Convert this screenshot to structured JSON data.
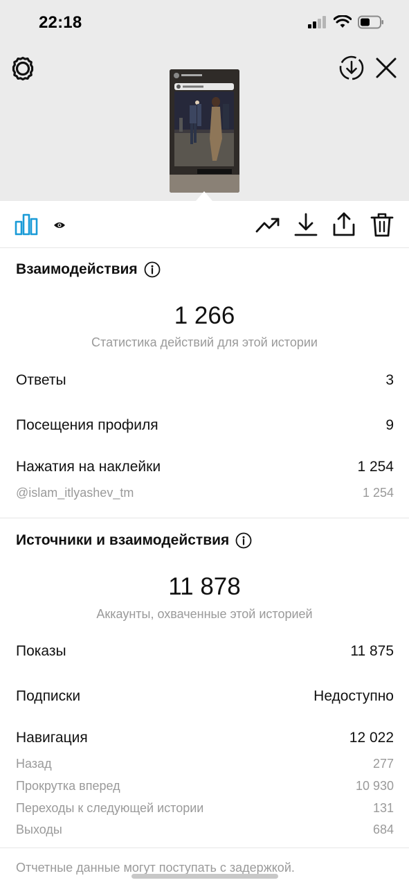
{
  "status_bar": {
    "time": "22:18"
  },
  "story": {
    "username": "islam_itlyashev_tm"
  },
  "interactions": {
    "title": "Взаимодействия",
    "total": "1 266",
    "caption": "Статистика действий для этой истории",
    "rows": [
      {
        "label": "Ответы",
        "value": "3"
      },
      {
        "label": "Посещения профиля",
        "value": "9"
      },
      {
        "label": "Нажатия на наклейки",
        "value": "1 254"
      }
    ],
    "sticker_row": {
      "label": "@islam_itlyashev_tm",
      "value": "1 254"
    }
  },
  "discovery": {
    "title": "Источники и взаимодействия",
    "total": "11 878",
    "caption": "Аккаунты, охваченные этой историей",
    "rows": [
      {
        "label": "Показы",
        "value": "11 875"
      },
      {
        "label": "Подписки",
        "value": "Недоступно"
      },
      {
        "label": "Навигация",
        "value": "12 022"
      }
    ],
    "navigation": [
      {
        "label": "Назад",
        "value": "277"
      },
      {
        "label": "Прокрутка вперед",
        "value": "10 930"
      },
      {
        "label": "Переходы к следующей истории",
        "value": "131"
      },
      {
        "label": "Выходы",
        "value": "684"
      }
    ]
  },
  "footer": {
    "note": "Отчетные данные могут поступать с задержкой."
  },
  "colors": {
    "accent": "#1a9bd7",
    "muted_text": "#9a9a9a",
    "top_background": "#ebebeb"
  }
}
